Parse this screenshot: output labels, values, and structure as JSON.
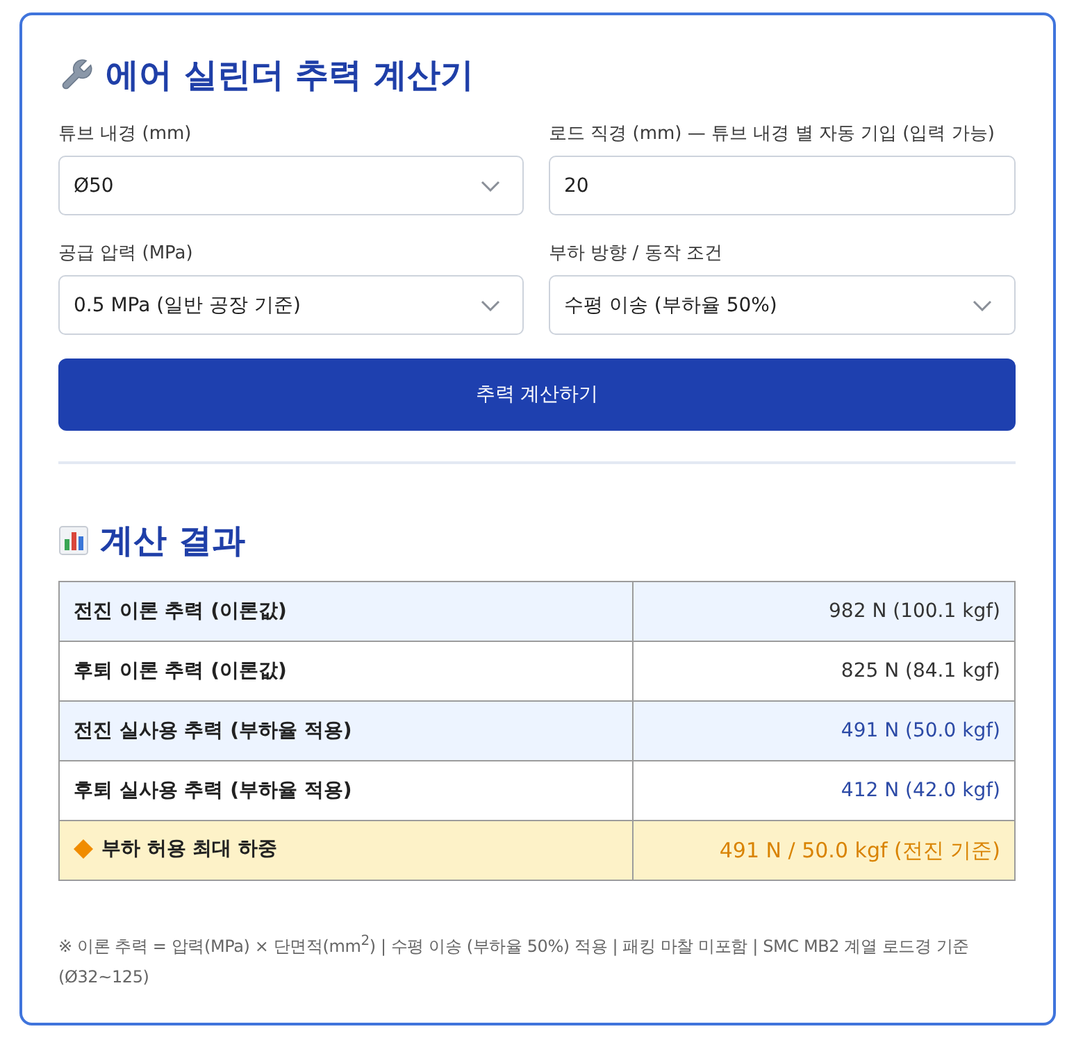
{
  "title": {
    "text": "에어 실린더 추력 계산기"
  },
  "form": {
    "fields": [
      {
        "kind": "select",
        "label": "튜브 내경 (mm)",
        "value": "Ø50"
      },
      {
        "kind": "input",
        "label": "로드 직경 (mm) — 튜브 내경 별 자동 기입 (입력 가능)",
        "value": "20"
      },
      {
        "kind": "select",
        "label": "공급 압력 (MPa)",
        "value": "0.5 MPa (일반 공장 기준)"
      },
      {
        "kind": "select",
        "label": "부하 방향 / 동작 조건",
        "value": "수평 이송 (부하율 50%)"
      }
    ]
  },
  "calculate_button": {
    "label": "추력 계산하기"
  },
  "results": {
    "title": "계산 결과",
    "rows": [
      {
        "kind": "theory",
        "label": "전진 이론 추력 (이론값)",
        "value": "982 N (100.1 kgf)"
      },
      {
        "kind": "theory",
        "label": "후퇴 이론 추력 (이론값)",
        "value": "825 N (84.1 kgf)"
      },
      {
        "kind": "actual",
        "label": "전진 실사용 추력 (부하율 적용)",
        "value": "491 N (50.0 kgf)"
      },
      {
        "kind": "actual",
        "label": "후퇴 실사용 추력 (부하율 적용)",
        "value": "412 N (42.0 kgf)"
      },
      {
        "kind": "max",
        "label": "부하 허용 최대 하중",
        "value": "491 N / 50.0 kgf (전진 기준)"
      }
    ]
  },
  "footnote": "※ 이론 추력 = 압력(MPa) × 단면적(mm$^{2}$) | 수평 이송 (부하율 50%) 적용 | 패킹 마찰 미포함 | SMC MB2 계열 로드경 기준 (Ø32~125)"
}
